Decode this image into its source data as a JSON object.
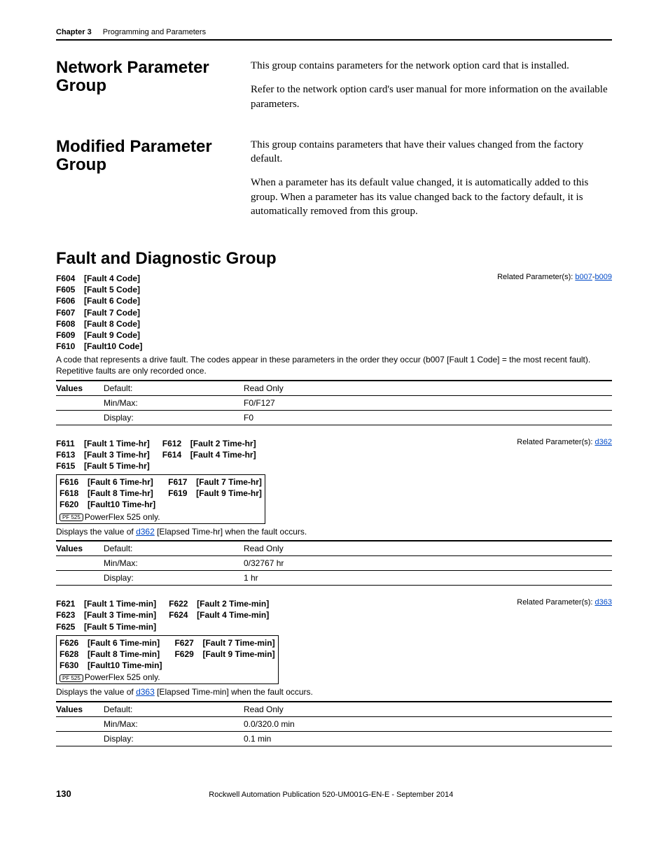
{
  "header": {
    "chapter": "Chapter 3",
    "title": "Programming and Parameters"
  },
  "sections": {
    "network": {
      "heading": "Network Parameter Group",
      "p1": "This group contains parameters for the network option card that is installed.",
      "p2": "Refer to the network option card's user manual for more information on the available parameters."
    },
    "modified": {
      "heading": "Modified Parameter Group",
      "p1": "This group contains parameters that have their values changed from the factory default.",
      "p2": "When a parameter has its default value changed, it is automatically added to this group. When a parameter has its value changed back to the factory default, it is automatically removed from this group."
    },
    "fault": {
      "heading": "Fault and Diagnostic Group"
    }
  },
  "block1": {
    "related_label": "Related Parameter(s): ",
    "related_link1": "b007",
    "related_sep": "-",
    "related_link2": "b009",
    "items": [
      {
        "code": "F604",
        "name": "[Fault 4 Code]"
      },
      {
        "code": "F605",
        "name": "[Fault 5 Code]"
      },
      {
        "code": "F606",
        "name": "[Fault 6 Code]"
      },
      {
        "code": "F607",
        "name": "[Fault 7 Code]"
      },
      {
        "code": "F608",
        "name": "[Fault 8 Code]"
      },
      {
        "code": "F609",
        "name": "[Fault 9 Code]"
      },
      {
        "code": "F610",
        "name": "[Fault10 Code]"
      }
    ],
    "desc": "A code that represents a drive fault. The codes appear in these parameters in the order they occur (b007 [Fault 1 Code] = the most recent fault). Repetitive faults are only recorded once.",
    "values": {
      "label": "Values",
      "k1": "Default:",
      "v1": "Read Only",
      "k2": "Min/Max:",
      "v2": "F0/F127",
      "k3": "Display:",
      "v3": "F0"
    }
  },
  "block2": {
    "related_label": "Related Parameter(s): ",
    "related_link": "d362",
    "colA1": [
      {
        "c": "F611",
        "n": "[Fault 1 Time-hr]"
      },
      {
        "c": "F613",
        "n": "[Fault 3 Time-hr]"
      },
      {
        "c": "F615",
        "n": "[Fault 5 Time-hr]"
      }
    ],
    "colA2": [
      {
        "c": "F612",
        "n": "[Fault 2 Time-hr]"
      },
      {
        "c": "F614",
        "n": "[Fault 4 Time-hr]"
      }
    ],
    "colB1": [
      {
        "c": "F616",
        "n": "[Fault 6 Time-hr]"
      },
      {
        "c": "F618",
        "n": "[Fault 8 Time-hr]"
      },
      {
        "c": "F620",
        "n": "[Fault10 Time-hr]"
      }
    ],
    "colB2": [
      {
        "c": "F617",
        "n": "[Fault 7 Time-hr]"
      },
      {
        "c": "F619",
        "n": "[Fault 9 Time-hr]"
      }
    ],
    "badge": "PF 525",
    "only": "PowerFlex 525 only.",
    "desc_pre": "Displays the value of ",
    "desc_link": "d362",
    "desc_post": " [Elapsed Time-hr] when the fault occurs.",
    "values": {
      "label": "Values",
      "k1": "Default:",
      "v1": "Read Only",
      "k2": "Min/Max:",
      "v2": "0/32767 hr",
      "k3": "Display:",
      "v3": "1 hr"
    }
  },
  "block3": {
    "related_label": "Related Parameter(s): ",
    "related_link": "d363",
    "colA1": [
      {
        "c": "F621",
        "n": "[Fault 1 Time-min]"
      },
      {
        "c": "F623",
        "n": "[Fault 3 Time-min]"
      },
      {
        "c": "F625",
        "n": "[Fault 5 Time-min]"
      }
    ],
    "colA2": [
      {
        "c": "F622",
        "n": "[Fault 2 Time-min]"
      },
      {
        "c": "F624",
        "n": "[Fault 4 Time-min]"
      }
    ],
    "colB1": [
      {
        "c": "F626",
        "n": "[Fault 6 Time-min]"
      },
      {
        "c": "F628",
        "n": "[Fault 8 Time-min]"
      },
      {
        "c": "F630",
        "n": "[Fault10 Time-min]"
      }
    ],
    "colB2": [
      {
        "c": "F627",
        "n": "[Fault 7 Time-min]"
      },
      {
        "c": "F629",
        "n": "[Fault 9 Time-min]"
      }
    ],
    "badge": "PF 525",
    "only": "PowerFlex 525 only.",
    "desc_pre": "Displays the value of ",
    "desc_link": "d363",
    "desc_post": " [Elapsed Time-min] when the fault occurs.",
    "values": {
      "label": "Values",
      "k1": "Default:",
      "v1": "Read Only",
      "k2": "Min/Max:",
      "v2": "0.0/320.0 min",
      "k3": "Display:",
      "v3": "0.1 min"
    }
  },
  "footer": {
    "page": "130",
    "pub": "Rockwell Automation Publication 520-UM001G-EN-E - September 2014"
  }
}
